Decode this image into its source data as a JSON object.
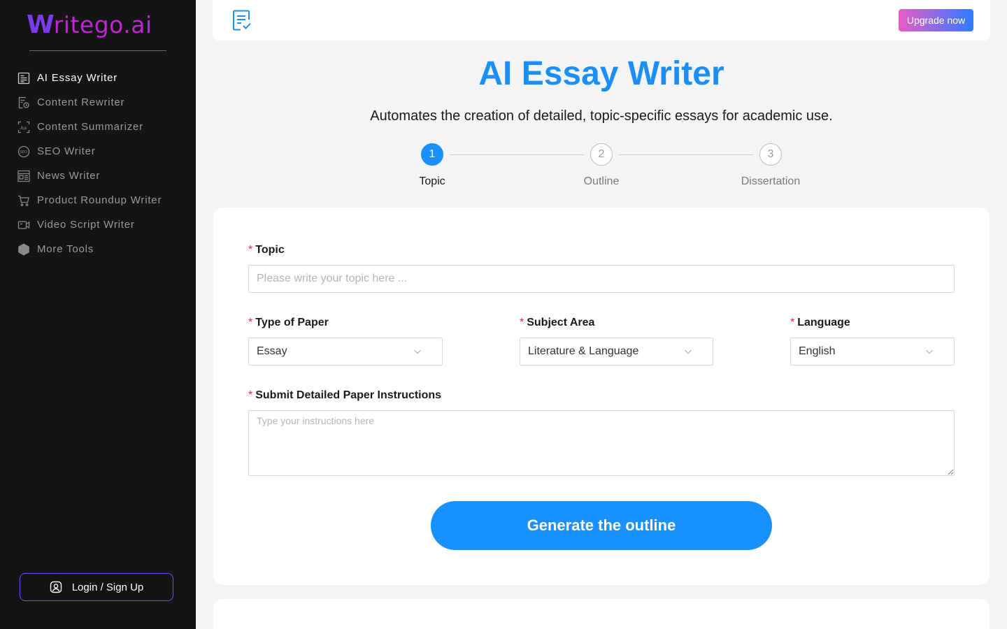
{
  "brand": {
    "logo_mark": "W",
    "logo_text": "ritego.ai"
  },
  "sidebar": {
    "items": [
      {
        "label": "AI Essay Writer",
        "icon": "essay-icon",
        "active": true
      },
      {
        "label": "Content Rewriter",
        "icon": "rewrite-icon",
        "active": false
      },
      {
        "label": "Content Summarizer",
        "icon": "summarize-icon",
        "active": false
      },
      {
        "label": "SEO Writer",
        "icon": "seo-icon",
        "active": false
      },
      {
        "label": "News Writer",
        "icon": "news-icon",
        "active": false
      },
      {
        "label": "Product Roundup Writer",
        "icon": "cart-icon",
        "active": false
      },
      {
        "label": "Video Script Writer",
        "icon": "video-icon",
        "active": false
      },
      {
        "label": "More Tools",
        "icon": "hexagon-icon",
        "active": false
      }
    ],
    "login_label": "Login / Sign Up"
  },
  "topbar": {
    "upgrade_label": "Upgrade now"
  },
  "page": {
    "title": "AI Essay Writer",
    "subtitle": "Automates the creation of detailed, topic-specific essays for academic use."
  },
  "steps": [
    {
      "number": "1",
      "label": "Topic",
      "active": true
    },
    {
      "number": "2",
      "label": "Outline",
      "active": false
    },
    {
      "number": "3",
      "label": "Dissertation",
      "active": false
    }
  ],
  "form": {
    "required_mark": "*",
    "topic": {
      "label": "Topic",
      "placeholder": "Please write your topic here ..."
    },
    "paper_type": {
      "label": "Type of Paper",
      "value": "Essay"
    },
    "subject_area": {
      "label": "Subject Area",
      "value": "Literature & Language"
    },
    "language": {
      "label": "Language",
      "value": "English"
    },
    "instructions": {
      "label": "Submit Detailed Paper Instructions",
      "placeholder": "Type your instructions here"
    },
    "submit_label": "Generate the outline"
  },
  "colors": {
    "accent": "#1890ff",
    "title": "#1d8ef5",
    "sidebar_bg": "#141414",
    "required": "#f5222d"
  }
}
